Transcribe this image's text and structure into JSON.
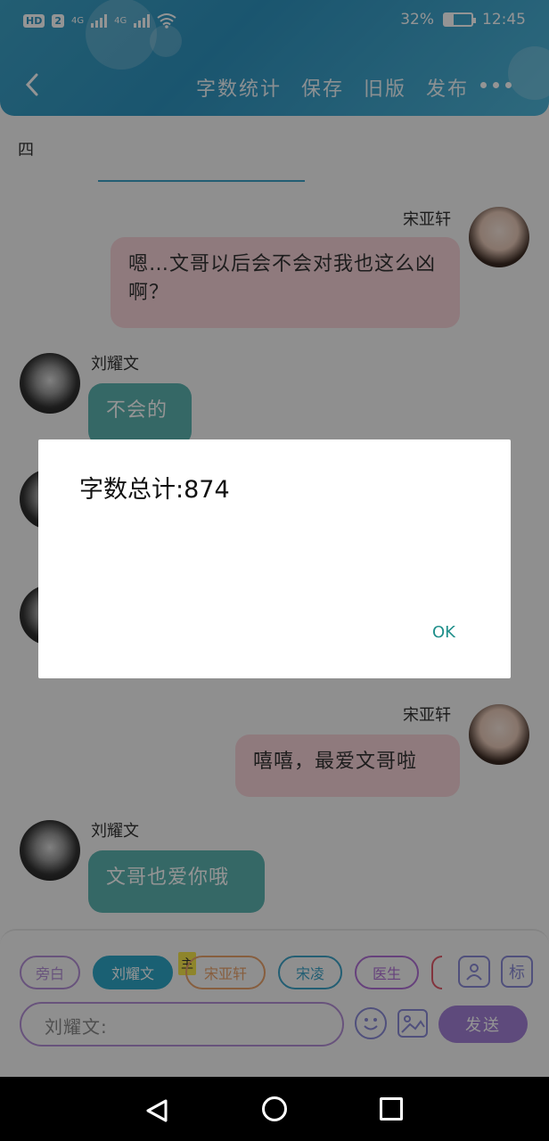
{
  "status_bar": {
    "hd": "HD",
    "sim": "2",
    "net1": "4G",
    "net2": "4G",
    "battery_pct": "32%",
    "battery_level": 0.32,
    "time": "12:45"
  },
  "nav": {
    "back_icon": "chevron-left-icon",
    "actions": [
      "字数统计",
      "保存",
      "旧版",
      "发布"
    ],
    "more_icon": "more-dots-icon"
  },
  "content": {
    "top_text": "四"
  },
  "messages": [
    {
      "side": "right",
      "name": "宋亚轩",
      "text": "嗯…文哥以后会不会对我也这么凶啊？",
      "color": "pink"
    },
    {
      "side": "left",
      "name": "刘耀文",
      "text": "不会的",
      "color": "teal"
    },
    {
      "side": "right",
      "name": "宋亚轩",
      "text": "嘻嘻，最爱文哥啦",
      "color": "pink"
    },
    {
      "side": "left",
      "name": "刘耀文",
      "text": "文哥也爱你哦",
      "color": "teal"
    }
  ],
  "bottom": {
    "chips": [
      "旁白",
      "刘耀文",
      "宋亚轩",
      "宋凌",
      "医生"
    ],
    "main_tag": "主",
    "label_button": "标",
    "input_placeholder": "刘耀文:",
    "send_label": "发送"
  },
  "dialog": {
    "message": "字数总计:874",
    "ok_label": "OK"
  },
  "colors": {
    "header": "#2e93bf",
    "accent_teal": "#5cb3b0",
    "accent_pink": "#f6d2d8",
    "send_purple": "#a380d6",
    "ok_text": "#1f8f8a"
  }
}
